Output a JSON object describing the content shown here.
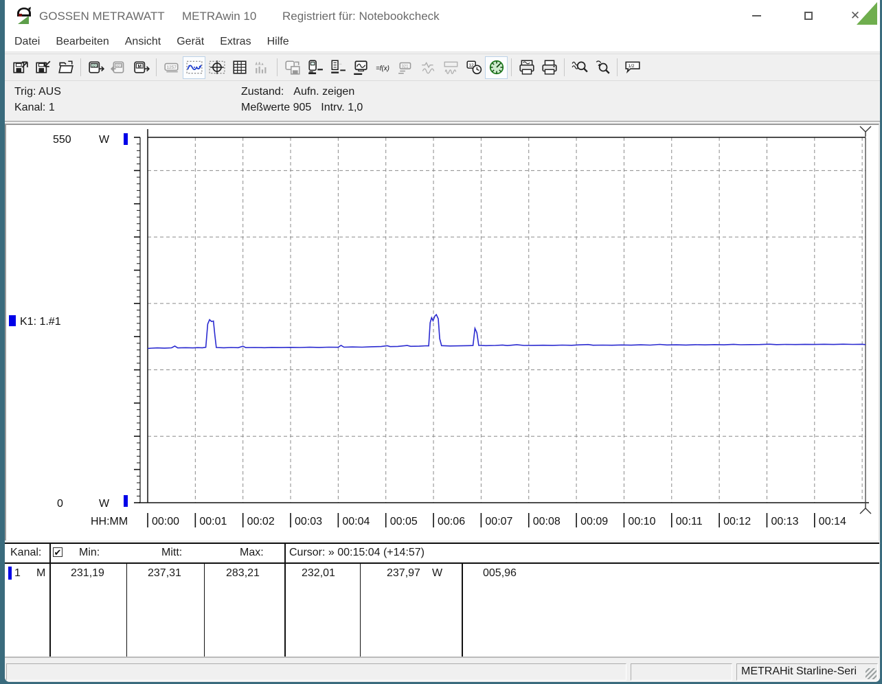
{
  "window": {
    "title_app": "GOSSEN METRAWATT",
    "title_product": "METRAwin 10",
    "title_registered": "Registriert für: Notebookcheck",
    "controls": {
      "minimize": "minimize",
      "maximize": "maximize",
      "close": "✕"
    }
  },
  "menu": {
    "items": [
      "Datei",
      "Bearbeiten",
      "Ansicht",
      "Gerät",
      "Extras",
      "Hilfe"
    ]
  },
  "toolbar": {
    "buttons": [
      {
        "name": "export-file-button",
        "glyph": "floppy-out",
        "state": "normal"
      },
      {
        "name": "save-file-button",
        "glyph": "floppy-in",
        "state": "normal"
      },
      {
        "name": "open-file-button",
        "glyph": "folder-open",
        "state": "normal"
      },
      {
        "sep": true
      },
      {
        "name": "read-device-button",
        "glyph": "device-out",
        "state": "normal"
      },
      {
        "name": "write-device-button",
        "glyph": "device-in",
        "state": "disabled"
      },
      {
        "name": "read-memory-button",
        "glyph": "device-m",
        "state": "normal"
      },
      {
        "sep": true
      },
      {
        "name": "numeric-display-button",
        "glyph": "display-digits",
        "state": "disabled"
      },
      {
        "name": "trend-view-button",
        "glyph": "waveform",
        "state": "pressed"
      },
      {
        "name": "xy-view-button",
        "glyph": "crosshair-scope",
        "state": "normal"
      },
      {
        "name": "table-view-button",
        "glyph": "table-grid",
        "state": "normal"
      },
      {
        "name": "histogram-view-button",
        "glyph": "histogram",
        "state": "disabled"
      },
      {
        "sep": true
      },
      {
        "name": "store-config-button",
        "glyph": "device-save",
        "state": "disabled"
      },
      {
        "name": "device-settings-button",
        "glyph": "device-tool",
        "state": "normal"
      },
      {
        "name": "channel-settings-button",
        "glyph": "list-tool",
        "state": "normal"
      },
      {
        "name": "monitor-button",
        "glyph": "monitor-wave",
        "state": "normal"
      },
      {
        "name": "function-button",
        "glyph": "fx",
        "state": "normal"
      },
      {
        "name": "online-display-button",
        "glyph": "display-small",
        "state": "disabled"
      },
      {
        "name": "single-curve-button",
        "glyph": "wave-single",
        "state": "disabled"
      },
      {
        "name": "multi-curve-button",
        "glyph": "wave-multi",
        "state": "disabled"
      },
      {
        "name": "time-settings-button",
        "glyph": "clock",
        "state": "normal"
      },
      {
        "name": "live-gauge-button",
        "glyph": "gauge-green",
        "state": "pressed"
      },
      {
        "sep": true
      },
      {
        "name": "print-preview-button",
        "glyph": "printer-wave",
        "state": "normal"
      },
      {
        "name": "print-button",
        "glyph": "printer",
        "state": "normal"
      },
      {
        "sep": true
      },
      {
        "name": "zoom-in-button",
        "glyph": "magnifier-wave",
        "state": "normal"
      },
      {
        "name": "zoom-out-button",
        "glyph": "magnifier-arrow",
        "state": "normal"
      },
      {
        "sep": true
      },
      {
        "name": "annotation-button",
        "glyph": "callout",
        "state": "normal"
      }
    ]
  },
  "info": {
    "trig": "Trig: AUS",
    "kanal": "Kanal: 1",
    "zustand_label": "Zustand:",
    "zustand_value": "Aufn. zeigen",
    "messwerte": "Meßwerte 905",
    "intrv": "Intrv. 1,0"
  },
  "chart_data": {
    "type": "line",
    "title": "",
    "ylabel_unit": "W",
    "y_top_label": "550",
    "y_bottom_label": "0",
    "ylim": [
      0,
      550
    ],
    "y_grid_interval": 100,
    "y_tick_minor": 10,
    "y_tick_major": 50,
    "x_prefix": "HH:MM",
    "x_tick_labels": [
      "00:00",
      "00:01",
      "00:02",
      "00:03",
      "00:04",
      "00:05",
      "00:06",
      "00:07",
      "00:08",
      "00:09",
      "00:10",
      "00:11",
      "00:12",
      "00:13",
      "00:14"
    ],
    "x_total_minutes": 15.07,
    "grid": "dashed",
    "legend_position": "left",
    "series": [
      {
        "name": "K1: 1.#1",
        "color": "#2a2ad0",
        "points": [
          [
            0.0,
            232.2
          ],
          [
            0.08,
            232.6
          ],
          [
            0.2,
            233.0
          ],
          [
            0.35,
            232.7
          ],
          [
            0.5,
            233.1
          ],
          [
            0.57,
            235.8
          ],
          [
            0.63,
            233.0
          ],
          [
            0.8,
            233.3
          ],
          [
            0.95,
            233.0
          ],
          [
            1.05,
            233.4
          ],
          [
            1.15,
            233.2
          ],
          [
            1.22,
            234.0
          ],
          [
            1.26,
            269.0
          ],
          [
            1.3,
            275.5
          ],
          [
            1.34,
            272.8
          ],
          [
            1.38,
            273.5
          ],
          [
            1.41,
            252.0
          ],
          [
            1.44,
            233.6
          ],
          [
            1.6,
            233.2
          ],
          [
            1.75,
            233.6
          ],
          [
            1.9,
            233.3
          ],
          [
            2.0,
            235.6
          ],
          [
            2.06,
            233.4
          ],
          [
            2.25,
            233.6
          ],
          [
            2.45,
            233.3
          ],
          [
            2.6,
            233.8
          ],
          [
            2.8,
            233.5
          ],
          [
            3.0,
            233.9
          ],
          [
            3.2,
            233.6
          ],
          [
            3.4,
            234.1
          ],
          [
            3.6,
            233.8
          ],
          [
            3.8,
            234.2
          ],
          [
            4.0,
            234.0
          ],
          [
            4.06,
            236.8
          ],
          [
            4.12,
            234.2
          ],
          [
            4.3,
            234.5
          ],
          [
            4.5,
            234.2
          ],
          [
            4.7,
            234.8
          ],
          [
            4.9,
            235.1
          ],
          [
            5.03,
            236.2
          ],
          [
            5.09,
            235.0
          ],
          [
            5.25,
            235.3
          ],
          [
            5.45,
            236.6
          ],
          [
            5.52,
            235.4
          ],
          [
            5.7,
            235.6
          ],
          [
            5.85,
            236.2
          ],
          [
            5.9,
            236.0
          ],
          [
            5.93,
            271.0
          ],
          [
            5.96,
            278.5
          ],
          [
            5.99,
            274.0
          ],
          [
            6.03,
            281.0
          ],
          [
            6.06,
            283.2
          ],
          [
            6.1,
            277.0
          ],
          [
            6.13,
            247.0
          ],
          [
            6.17,
            236.4
          ],
          [
            6.35,
            235.9
          ],
          [
            6.55,
            236.1
          ],
          [
            6.75,
            236.4
          ],
          [
            6.83,
            236.6
          ],
          [
            6.87,
            262.5
          ],
          [
            6.91,
            256.0
          ],
          [
            6.95,
            236.8
          ],
          [
            7.1,
            236.4
          ],
          [
            7.3,
            236.7
          ],
          [
            7.45,
            237.4
          ],
          [
            7.55,
            236.5
          ],
          [
            7.75,
            237.9
          ],
          [
            7.9,
            236.7
          ],
          [
            8.1,
            236.9
          ],
          [
            8.3,
            237.1
          ],
          [
            8.5,
            236.8
          ],
          [
            8.7,
            237.3
          ],
          [
            8.9,
            237.0
          ],
          [
            9.05,
            237.6
          ],
          [
            9.25,
            238.1
          ],
          [
            9.35,
            237.1
          ],
          [
            9.55,
            237.3
          ],
          [
            9.75,
            237.1
          ],
          [
            9.95,
            237.5
          ],
          [
            10.15,
            237.2
          ],
          [
            10.35,
            237.7
          ],
          [
            10.55,
            237.3
          ],
          [
            10.75,
            238.3
          ],
          [
            10.9,
            237.5
          ],
          [
            11.1,
            237.7
          ],
          [
            11.3,
            237.4
          ],
          [
            11.5,
            237.9
          ],
          [
            11.7,
            237.6
          ],
          [
            11.9,
            238.0
          ],
          [
            12.1,
            237.7
          ],
          [
            12.3,
            238.4
          ],
          [
            12.45,
            237.8
          ],
          [
            12.65,
            238.0
          ],
          [
            12.85,
            238.1
          ],
          [
            13.05,
            238.6
          ],
          [
            13.2,
            238.0
          ],
          [
            13.4,
            238.3
          ],
          [
            13.6,
            238.1
          ],
          [
            13.8,
            238.4
          ],
          [
            14.0,
            238.2
          ],
          [
            14.2,
            238.5
          ],
          [
            14.4,
            238.2
          ],
          [
            14.6,
            238.6
          ],
          [
            14.8,
            238.3
          ],
          [
            15.0,
            238.5
          ],
          [
            15.07,
            238.0
          ]
        ]
      }
    ],
    "cursor": {
      "time": "00:15:04",
      "offset": "(+14:57)",
      "position_min": 15.07
    }
  },
  "table": {
    "headers": {
      "kanal": "Kanal:",
      "min": "Min:",
      "mitt": "Mitt:",
      "max": "Max:",
      "cursor": "Cursor: » 00:15:04 (+14:57)"
    },
    "checkbox_checked": "✔",
    "row": {
      "channel": "1",
      "flag": "M",
      "min": "231,19",
      "mitt": "237,31",
      "max": "283,21",
      "cursor_left": "232,01",
      "cursor_right": "237,97",
      "unit": "W",
      "delta": "005,96"
    }
  },
  "statusbar": {
    "device": "METRAHit Starline-Seri"
  },
  "colors": {
    "curve_blue": "#2a2ad0",
    "marker_blue": "#0000e8",
    "corner_green": "#6fae4e",
    "grid_gray": "#8a8a8a",
    "frame_teal": "#3a6b7d"
  }
}
